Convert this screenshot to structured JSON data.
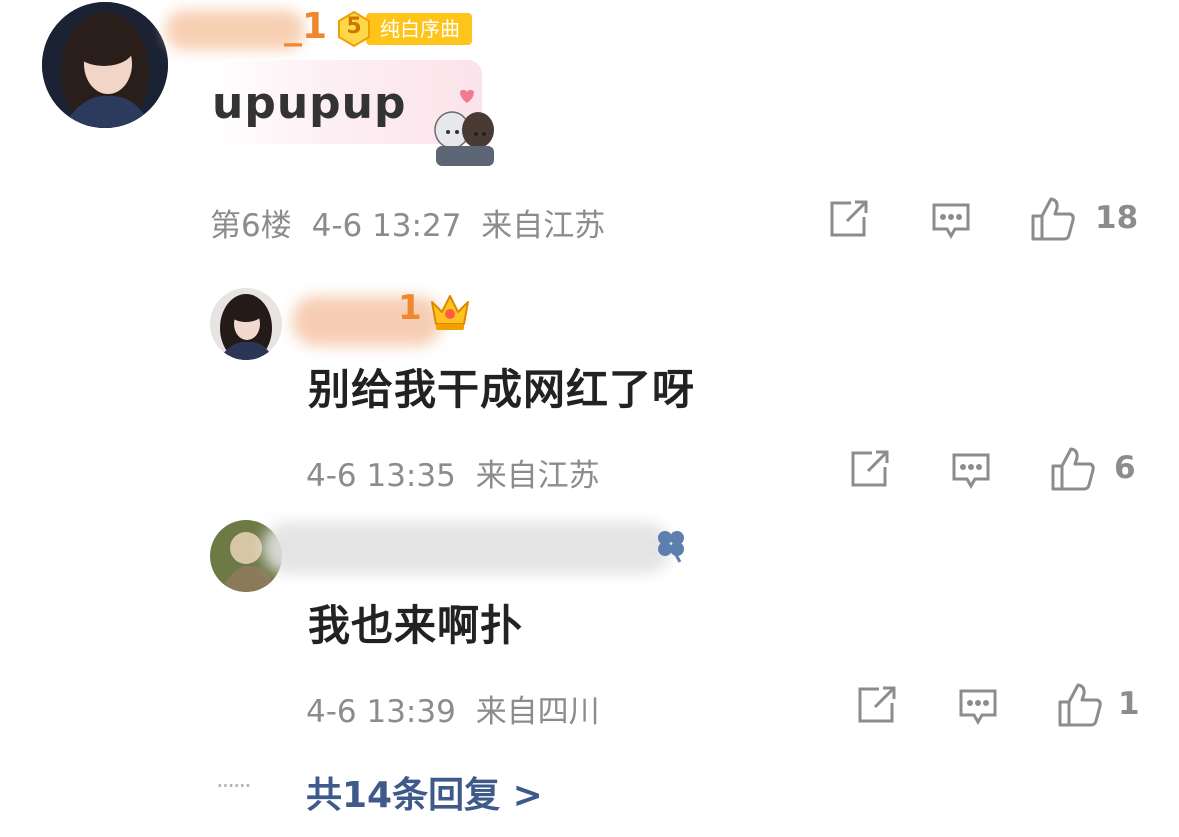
{
  "colors": {
    "meta_gray": "#8c8c8c",
    "link_blue": "#3f5a8a",
    "username_orange": "#f0872c",
    "badge_yellow": "#ffc41a",
    "bubble_pink": "#fbe3ea"
  },
  "main_comment": {
    "username_suffix": "_1",
    "badge_level": "5",
    "badge_text": "纯白序曲",
    "text": "upupup",
    "floor": "第6楼",
    "datetime": "4-6 13:27",
    "location": "来自江苏",
    "like_count": "18",
    "icons": [
      "share-icon",
      "comment-icon",
      "like-icon"
    ]
  },
  "replies": [
    {
      "username_suffix": "1",
      "text": "别给我干成网红了呀",
      "datetime": "4-6 13:35",
      "location": "来自江苏",
      "like_count": "6"
    },
    {
      "text": "我也来啊扑",
      "datetime": "4-6 13:39",
      "location": "来自四川",
      "like_count": "1"
    }
  ],
  "more_replies": {
    "dots": "······",
    "label": "共14条回复 >"
  }
}
